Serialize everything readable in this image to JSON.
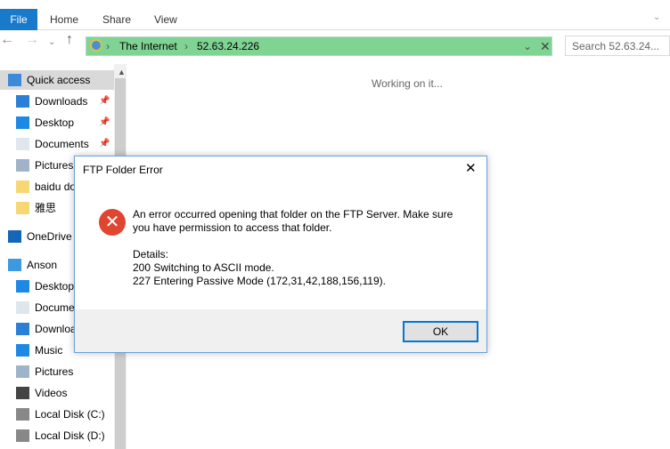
{
  "ribbon": {
    "tabs": [
      "File",
      "Home",
      "Share",
      "View"
    ]
  },
  "address": {
    "segments": [
      "The Internet",
      "52.63.24.226"
    ]
  },
  "search": {
    "placeholder": "Search 52.63.24..."
  },
  "status": "Working on it...",
  "sidebar": {
    "items": [
      {
        "label": "Quick access",
        "icon": "star-icon"
      },
      {
        "label": "Downloads",
        "icon": "download-icon",
        "pinned": true
      },
      {
        "label": "Desktop",
        "icon": "desktop-icon",
        "pinned": true
      },
      {
        "label": "Documents",
        "icon": "document-icon",
        "pinned": true
      },
      {
        "label": "Pictures",
        "icon": "pictures-icon"
      },
      {
        "label": "baidu do",
        "icon": "folder-icon"
      },
      {
        "label": "雅思",
        "icon": "folder-icon"
      },
      {
        "label": "OneDrive",
        "icon": "cloud-icon"
      },
      {
        "label": "Anson",
        "icon": "computer-icon"
      },
      {
        "label": "Desktop",
        "icon": "desktop-icon"
      },
      {
        "label": "Docume",
        "icon": "document-icon"
      },
      {
        "label": "Downloa",
        "icon": "download-icon"
      },
      {
        "label": "Music",
        "icon": "music-icon"
      },
      {
        "label": "Pictures",
        "icon": "pictures-icon"
      },
      {
        "label": "Videos",
        "icon": "video-icon"
      },
      {
        "label": "Local Disk (C:)",
        "icon": "drive-icon"
      },
      {
        "label": "Local Disk (D:)",
        "icon": "drive-icon"
      }
    ]
  },
  "dialog": {
    "title": "FTP Folder Error",
    "message1": "An error occurred opening that folder on the FTP Server.  Make sure",
    "message2": "you have permission to access that folder.",
    "details_label": "Details:",
    "detail1": "200 Switching to ASCII mode.",
    "detail2": "227 Entering Passive Mode (172,31,42,188,156,119).",
    "ok": "OK"
  },
  "colors": {
    "accent": "#1979ca",
    "address_bg": "#7fd393",
    "error": "#e0452f"
  }
}
